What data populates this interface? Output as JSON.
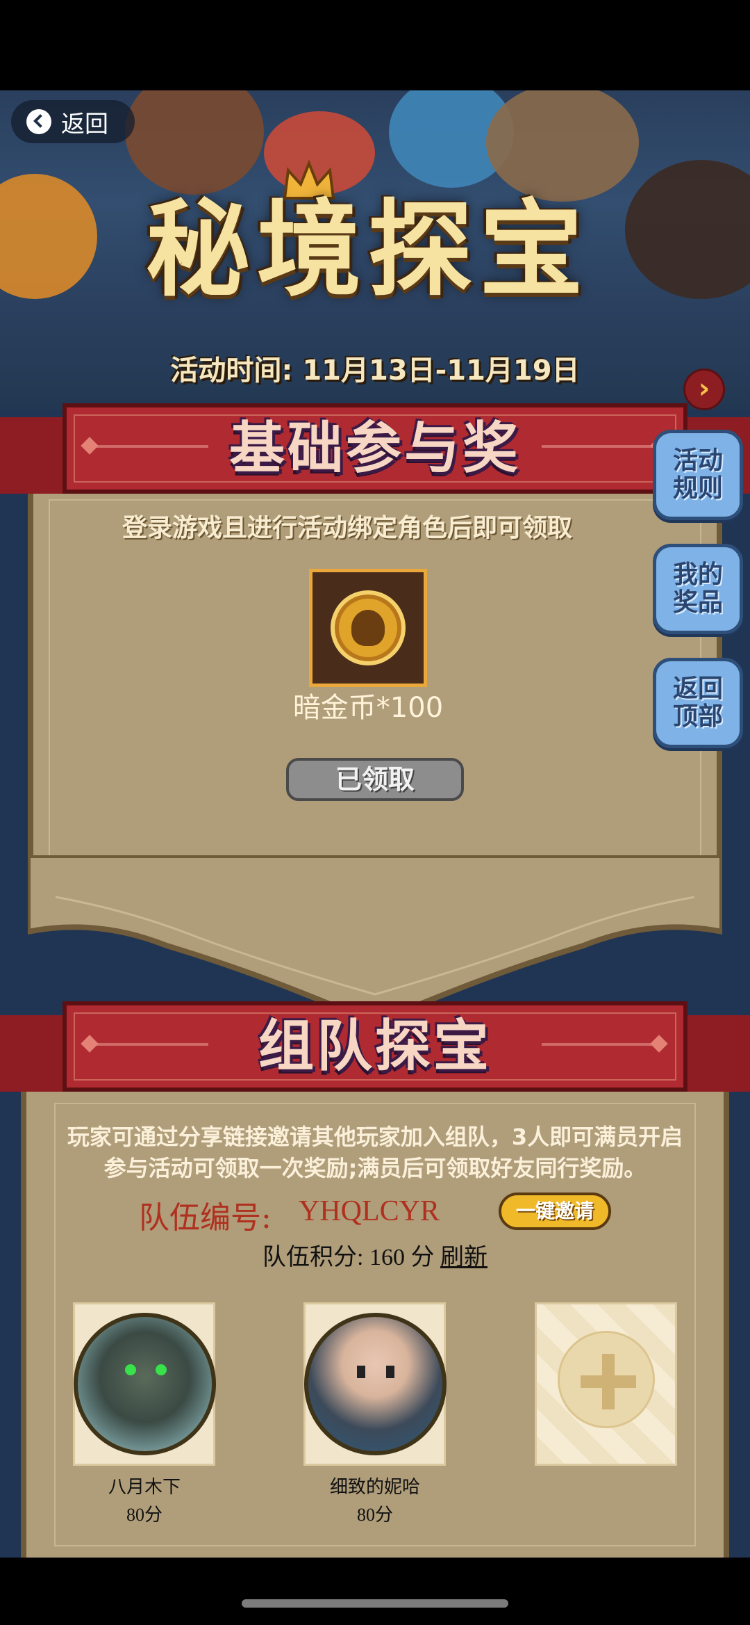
{
  "nav": {
    "back_label": "返回"
  },
  "hero": {
    "title": "秘境探宝",
    "event_time": "活动时间: 11月13日-11月19日"
  },
  "side_buttons": [
    {
      "label": "活动\n规则"
    },
    {
      "label": "我的\n奖品"
    },
    {
      "label": "返回\n顶部"
    }
  ],
  "basic_reward": {
    "title": "基础参与奖",
    "description": "登录游戏且进行活动绑定角色后即可领取",
    "item_label": "暗金币*100",
    "button_label": "已领取"
  },
  "team": {
    "title": "组队探宝",
    "description_line1": "玩家可通过分享链接邀请其他玩家加入组队，3人即可满员开启",
    "description_line2": "参与活动可领取一次奖励;满员后可领取好友同行奖励。",
    "team_id_label": "队伍编号:",
    "team_id": "YHQLCYR",
    "invite_label": "一键邀请",
    "score_prefix": "队伍积分:",
    "score_value": "160 分",
    "refresh_label": "刷新",
    "members": [
      {
        "name": "八月木下",
        "score": "80分"
      },
      {
        "name": "细致的妮哈",
        "score": "80分"
      }
    ]
  }
}
